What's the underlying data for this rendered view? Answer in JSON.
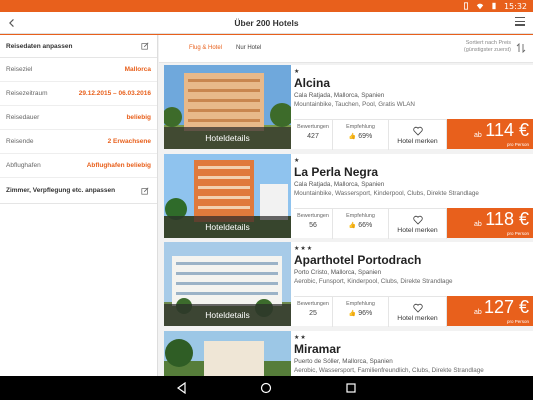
{
  "statusbar": {
    "time": "15:32"
  },
  "appbar": {
    "title": "Über 200 Hotels"
  },
  "left": {
    "header": "Reisedaten anpassen",
    "rows": [
      {
        "key": "Reiseziel",
        "value": "Mallorca"
      },
      {
        "key": "Reisezeitraum",
        "value": "29.12.2015 – 06.03.2016"
      },
      {
        "key": "Reisedauer",
        "value": "beliebig"
      },
      {
        "key": "Reisende",
        "value": "2 Erwachsene"
      },
      {
        "key": "Abflughafen",
        "value": "Abflughafen beliebig"
      }
    ],
    "footer": "Zimmer, Verpflegung etc. anpassen"
  },
  "tabs": {
    "flight_hotel": "Flug & Hotel",
    "hotel_only": "Nur Hotel"
  },
  "sort": {
    "line1": "Sortiert nach Preis",
    "line2": "(günstigster zuerst)"
  },
  "labels": {
    "details": "Hoteldetails",
    "ratings": "Bewertungen",
    "recommend": "Empfehlung",
    "remember": "Hotel merken",
    "from": "ab",
    "per_person": "pro Person"
  },
  "hotels": [
    {
      "stars": "★",
      "name": "Alcina",
      "location": "Cala Ratjada, Mallorca, Spanien",
      "features": "Mountainbike, Tauchen, Pool, Gratis WLAN",
      "ratings": "427",
      "recommend": "69%",
      "price": "114 €"
    },
    {
      "stars": "★",
      "name": "La Perla Negra",
      "location": "Cala Ratjada, Mallorca, Spanien",
      "features": "Mountainbike, Wassersport, Kinderpool, Clubs, Direkte Strandlage",
      "ratings": "56",
      "recommend": "66%",
      "price": "118 €"
    },
    {
      "stars": "★★★",
      "name": "Aparthotel Portodrach",
      "location": "Porto Cristo, Mallorca, Spanien",
      "features": "Aerobic, Funsport, Kinderpool, Clubs, Direkte Strandlage",
      "ratings": "25",
      "recommend": "96%",
      "price": "127 €"
    },
    {
      "stars": "★★",
      "name": "Miramar",
      "location": "Puerto de Sóller, Mallorca, Spanien",
      "features": "Aerobic, Wassersport, Familienfreundlich, Clubs, Direkte Strandlage",
      "ratings": "",
      "recommend": "",
      "price": ""
    }
  ],
  "colors": {
    "accent": "#e8601c"
  },
  "icons": {
    "back": "arrow-left-icon",
    "menu": "hamburger-icon",
    "edit": "edit-icon",
    "sort": "sort-icon",
    "heart": "heart-icon",
    "thumb": "thumb-up-icon"
  }
}
